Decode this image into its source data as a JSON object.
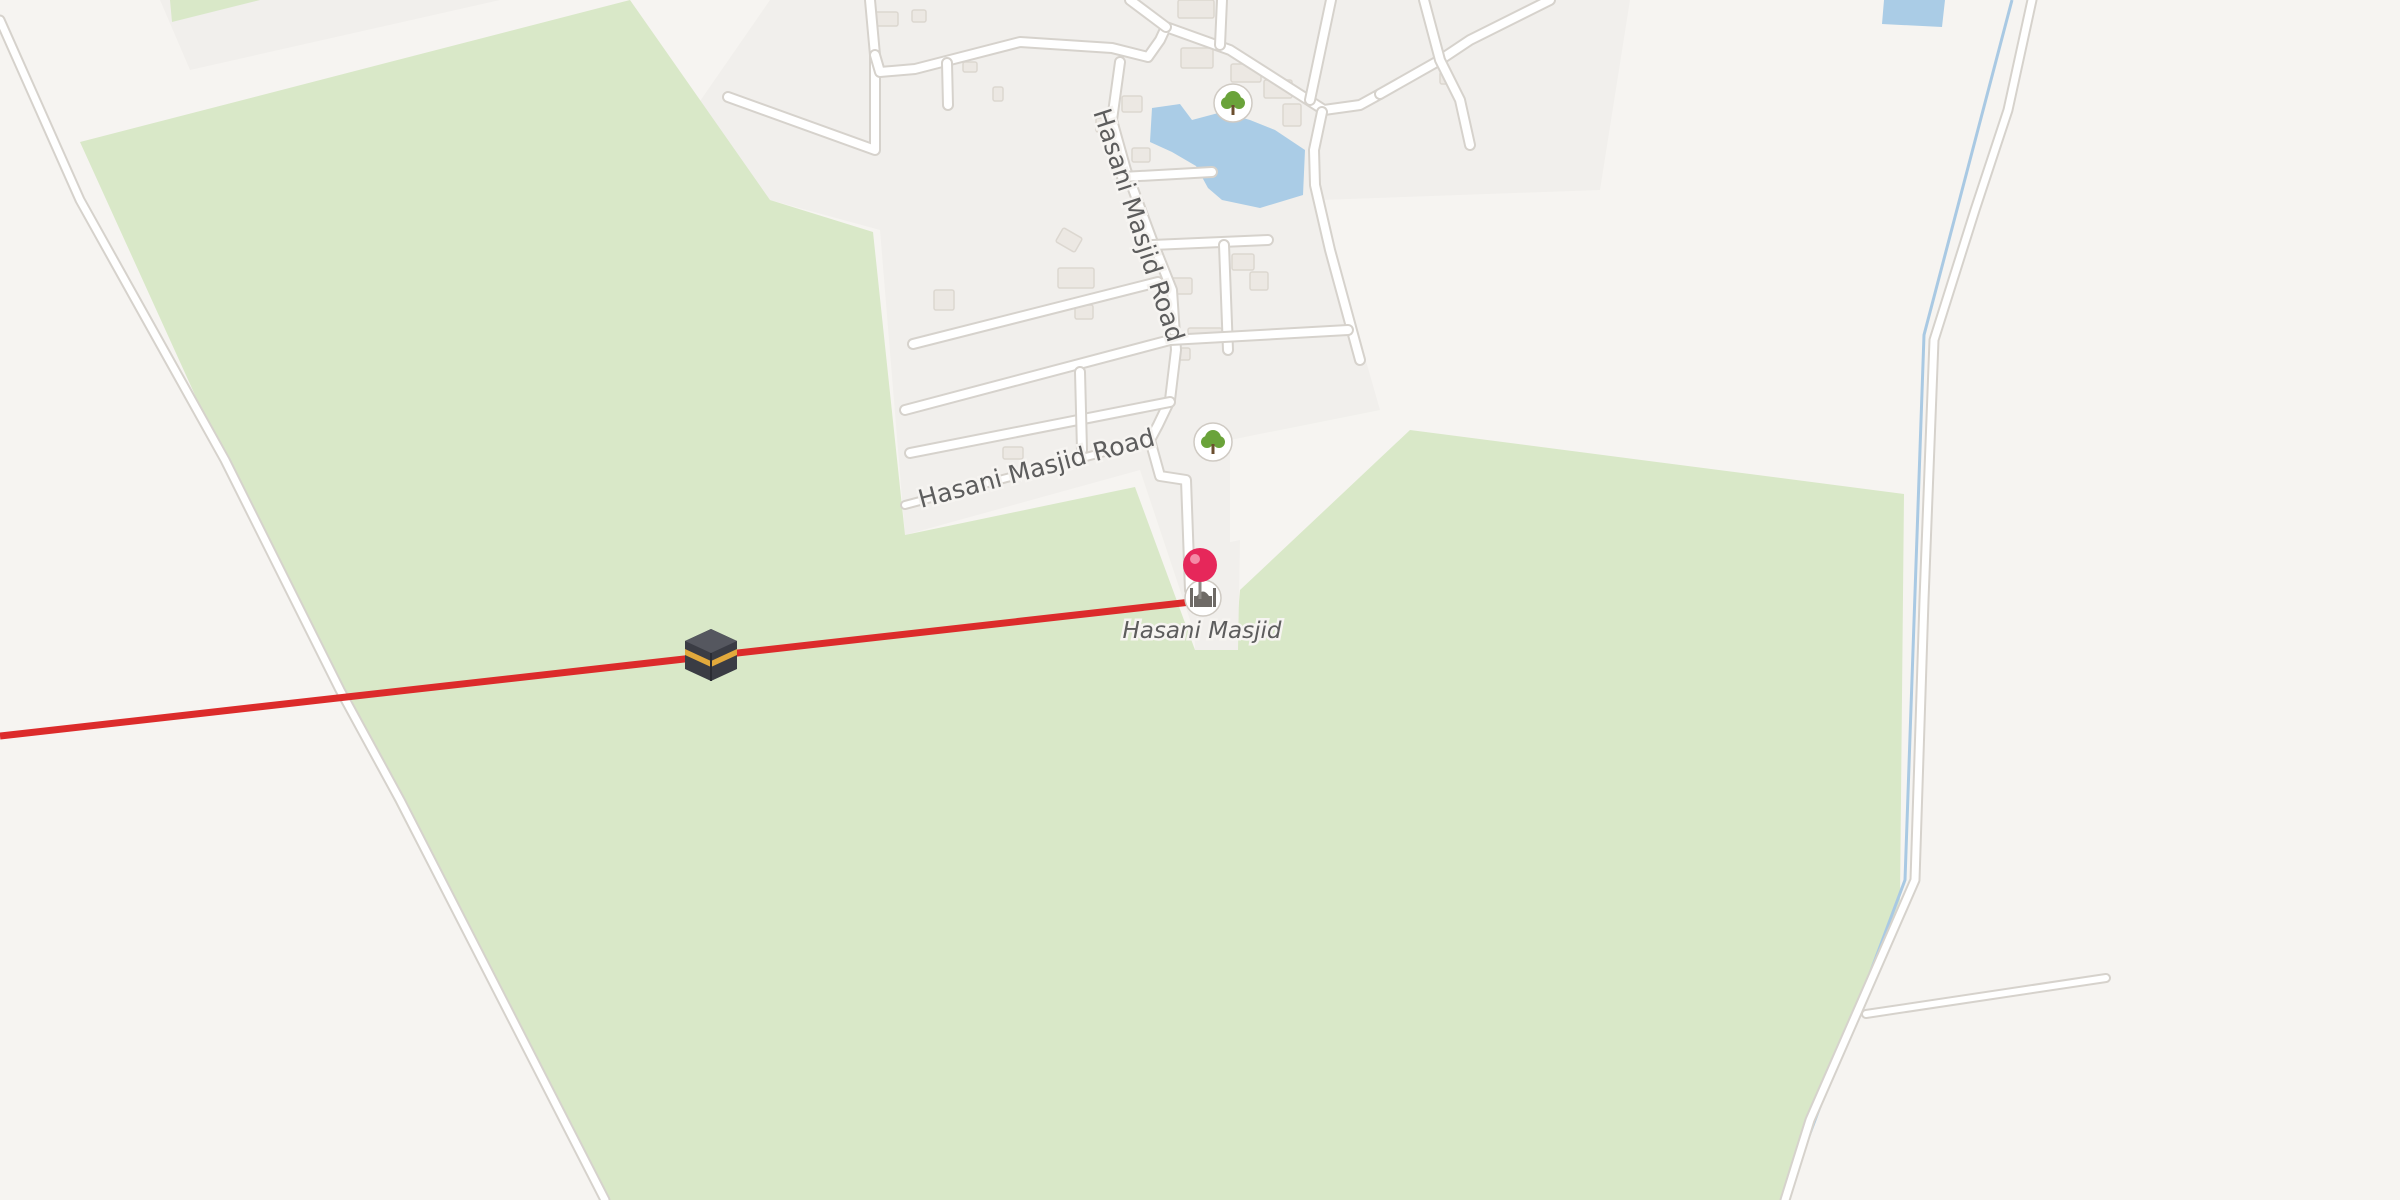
{
  "map": {
    "colors": {
      "background": "#f6f4f1",
      "residential": "#f1efec",
      "park": "#d9e8c8",
      "water": "#aacce6",
      "road": "#ffffff",
      "qibla_line": "#dc2b2b",
      "pin": "#e6275a",
      "tree_icon": "#6aa33a"
    },
    "labels": {
      "road_upper": "Hasani Masjid Road",
      "road_lower": "Hasani Masjid Road",
      "poi": "Hasani Masjid"
    },
    "icons": {
      "location_pin": "map-pin-icon",
      "mosque": "mosque-icon",
      "kaaba": "kaaba-icon",
      "tree": "tree-icon"
    }
  }
}
